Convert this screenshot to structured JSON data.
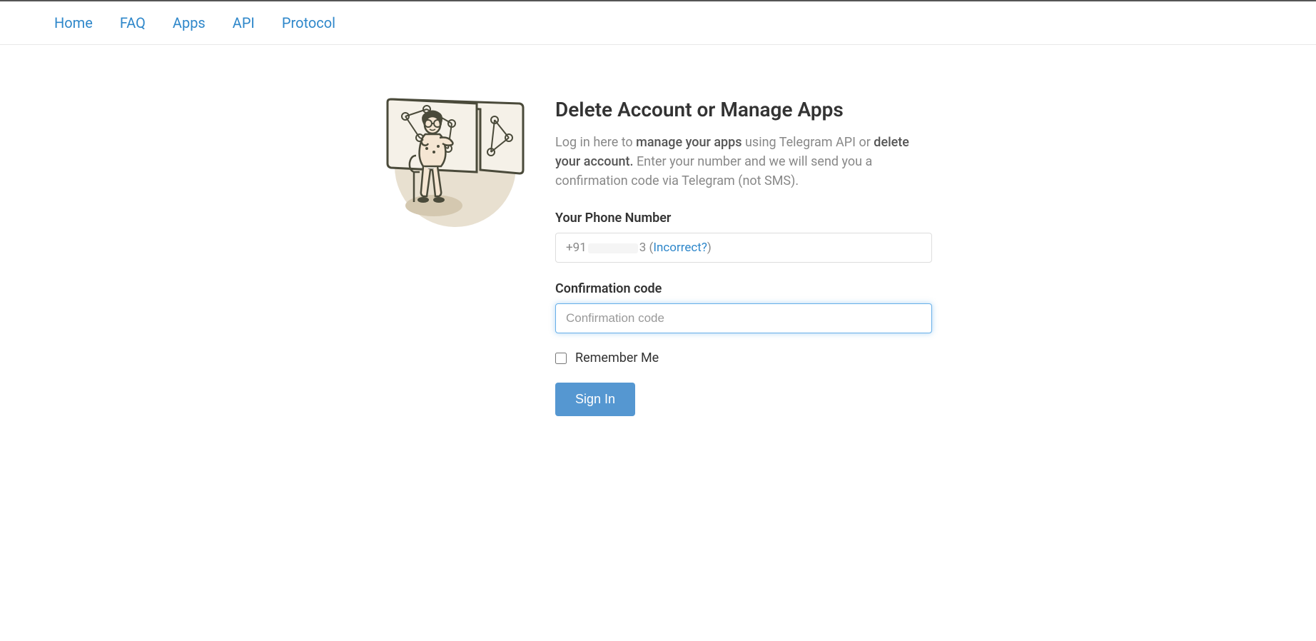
{
  "nav": {
    "home": "Home",
    "faq": "FAQ",
    "apps": "Apps",
    "api": "API",
    "protocol": "Protocol"
  },
  "page": {
    "title": "Delete Account or Manage Apps",
    "intro_part1": "Log in here to ",
    "intro_strong1": "manage your apps",
    "intro_part2": " using Telegram API or ",
    "intro_strong2": "delete your account.",
    "intro_part3": " Enter your number and we will send you a confirmation code via Telegram (not SMS)."
  },
  "form": {
    "phone_label": "Your Phone Number",
    "phone_prefix": "+91",
    "phone_suffix": "3",
    "incorrect_link": "Incorrect?",
    "code_label": "Confirmation code",
    "code_placeholder": "Confirmation code",
    "remember_label": "Remember Me",
    "signin_label": "Sign In"
  }
}
